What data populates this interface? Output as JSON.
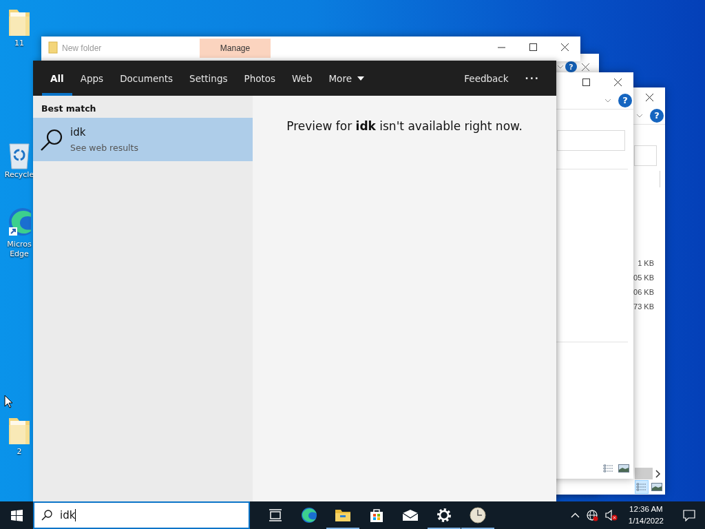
{
  "desktop_icons": [
    {
      "kind": "folder",
      "lines": [
        "11"
      ]
    },
    {
      "kind": "recycle",
      "lines": [
        "Recycle"
      ]
    },
    {
      "kind": "edge",
      "lines": [
        "Micros",
        "Edge"
      ]
    },
    {
      "kind": "folder",
      "lines": [
        "2"
      ]
    }
  ],
  "windows": [
    {
      "kind": "explorer",
      "title": "New folder",
      "ribbon_tab": "Manage"
    },
    {
      "kind": "back",
      "help": "?"
    },
    {
      "kind": "middle",
      "help": "?",
      "views": [
        {
          "kind": "details",
          "selected": false
        },
        {
          "kind": "thumbnails",
          "selected": false
        }
      ]
    },
    {
      "kind": "front",
      "help": "?",
      "sizes": [
        "1 KB",
        "05 KB",
        "06 KB",
        "73 KB"
      ],
      "views": [
        {
          "kind": "details",
          "selected": true
        },
        {
          "kind": "thumbnails",
          "selected": false
        }
      ]
    }
  ],
  "search": {
    "tabs": [
      {
        "label": "All",
        "selected": true
      },
      {
        "label": "Apps",
        "selected": false
      },
      {
        "label": "Documents",
        "selected": false
      },
      {
        "label": "Settings",
        "selected": false
      },
      {
        "label": "Photos",
        "selected": false
      },
      {
        "label": "Web",
        "selected": false
      }
    ],
    "more": "More",
    "feedback": "Feedback",
    "menu": "···",
    "section": "Best match",
    "result": {
      "title": "idk",
      "subtitle": "See web results",
      "selected": true
    },
    "preview": "Preview for **idk** isn't available right now.",
    "query": "idk"
  },
  "taskbar": {
    "apps": [
      {
        "kind": "taskview",
        "running": false
      },
      {
        "kind": "edge",
        "running": false
      },
      {
        "kind": "explorer",
        "running": true
      },
      {
        "kind": "store",
        "running": false
      },
      {
        "kind": "mail",
        "running": false
      },
      {
        "kind": "settings",
        "running": true
      },
      {
        "kind": "clock",
        "running": true
      }
    ],
    "time": "12:36 AM",
    "date": "1/14/2022"
  }
}
